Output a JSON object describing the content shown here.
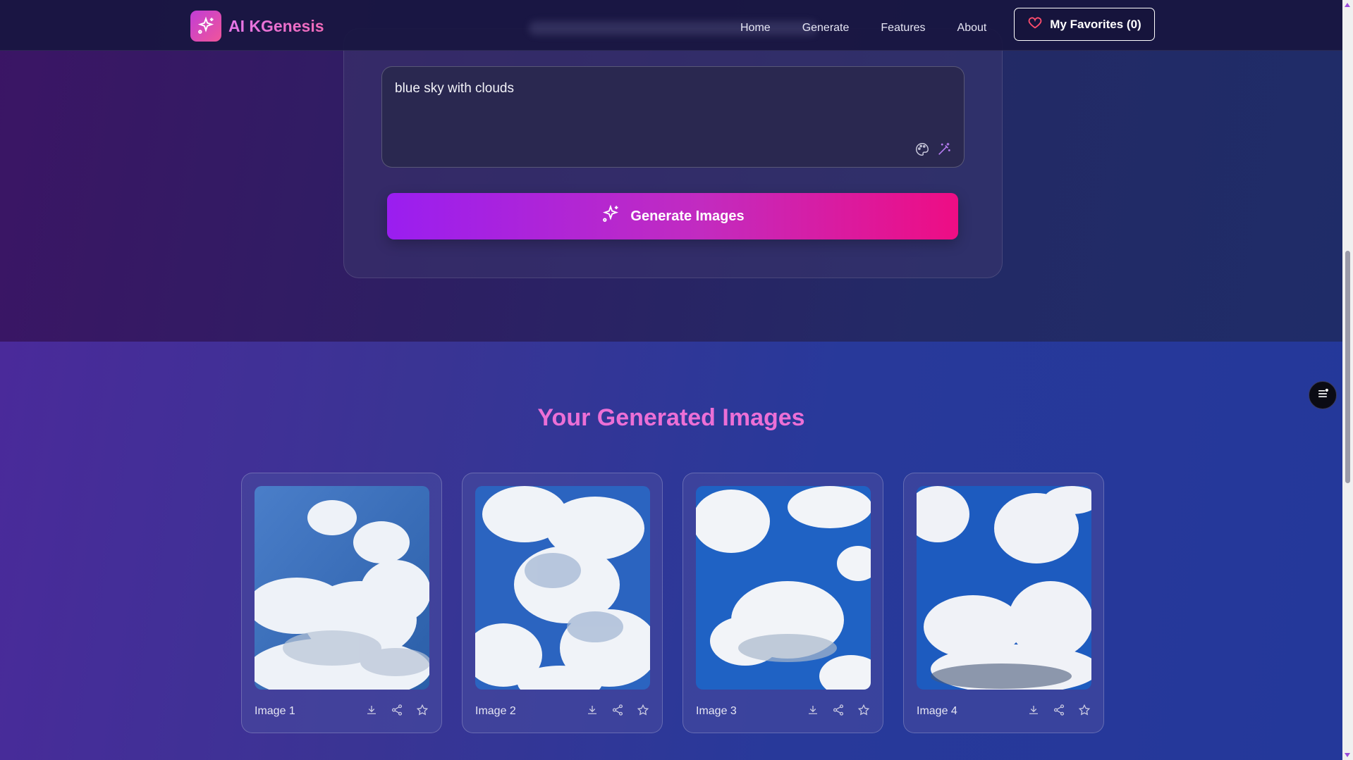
{
  "app": {
    "name": "AI KGenesis",
    "logo_icon": "sparkles-icon"
  },
  "nav": {
    "links": [
      "Home",
      "Generate",
      "Features",
      "About"
    ],
    "favorites_label": "My Favorites (0)",
    "favorites_icon": "heart-icon"
  },
  "prompt": {
    "value": "blue sky with clouds",
    "icons": [
      "palette-icon",
      "magic-wand-icon"
    ]
  },
  "generate_button": {
    "label": "Generate Images",
    "icon": "sparkles-icon"
  },
  "results": {
    "title": "Your Generated Images",
    "images": [
      {
        "label": "Image 1"
      },
      {
        "label": "Image 2"
      },
      {
        "label": "Image 3"
      },
      {
        "label": "Image 4"
      }
    ],
    "actions": [
      "download-icon",
      "share-icon",
      "star-icon"
    ]
  },
  "colors": {
    "accent_pink": "#ec6fd6",
    "button_start": "#9a1ef0",
    "button_end": "#ee0d84"
  }
}
